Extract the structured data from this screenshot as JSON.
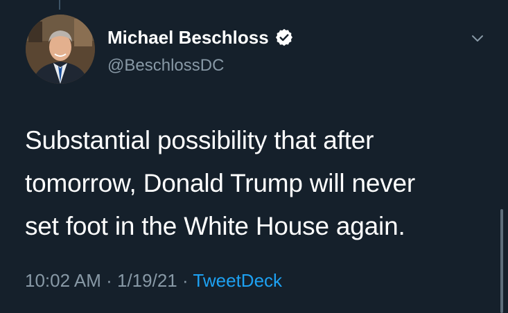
{
  "tweet": {
    "author": {
      "display_name": "Michael Beschloss",
      "handle": "@BeschlossDC",
      "verified_icon": "verified-badge-icon",
      "avatar": "profile-photo"
    },
    "menu_icon": "chevron-down-icon",
    "text_lines": [
      "Substantial possibility that after",
      "tomorrow, Donald Trump will never",
      "set foot in the White House again."
    ],
    "time": "10:02 AM",
    "separator": "·",
    "date": "1/19/21",
    "source": "TweetDeck"
  },
  "colors": {
    "background": "#15202b",
    "primary_text": "#ffffff",
    "secondary_text": "#8899a6",
    "accent": "#1da1f2"
  }
}
